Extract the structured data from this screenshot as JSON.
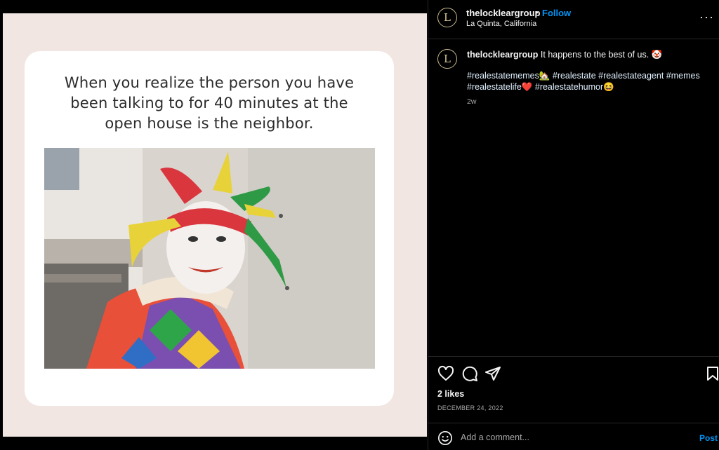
{
  "post": {
    "username": "thelockleargroup",
    "follow_label": "Follow",
    "separator": "•",
    "location": "La Quinta, California",
    "avatar_letter": "L",
    "caption_text": "It happens to the best of us. 🤡",
    "hashtags_line1": "#realestatememes🏡 #realestate #realestateagent #memes",
    "hashtags_line2": "#realestatelife❤️ #realestatehumor😆",
    "time_ago": "2w",
    "likes": "2 likes",
    "date": "DECEMBER 24, 2022",
    "more_label": "···"
  },
  "meme": {
    "text_line1": "When you realize the person you have",
    "text_line2": "been talking to for 40 minutes at the",
    "text_line3": "open house is the neighbor."
  },
  "comment": {
    "placeholder": "Add a comment...",
    "post_label": "Post"
  },
  "icons": {
    "like": "heart-icon",
    "comment": "comment-icon",
    "share": "share-icon",
    "save": "bookmark-icon",
    "emoji": "smiley-icon",
    "more": "more-options-icon"
  },
  "colors": {
    "accent": "#0095f6",
    "background": "#000000",
    "meme_background": "#f1e6e2"
  }
}
